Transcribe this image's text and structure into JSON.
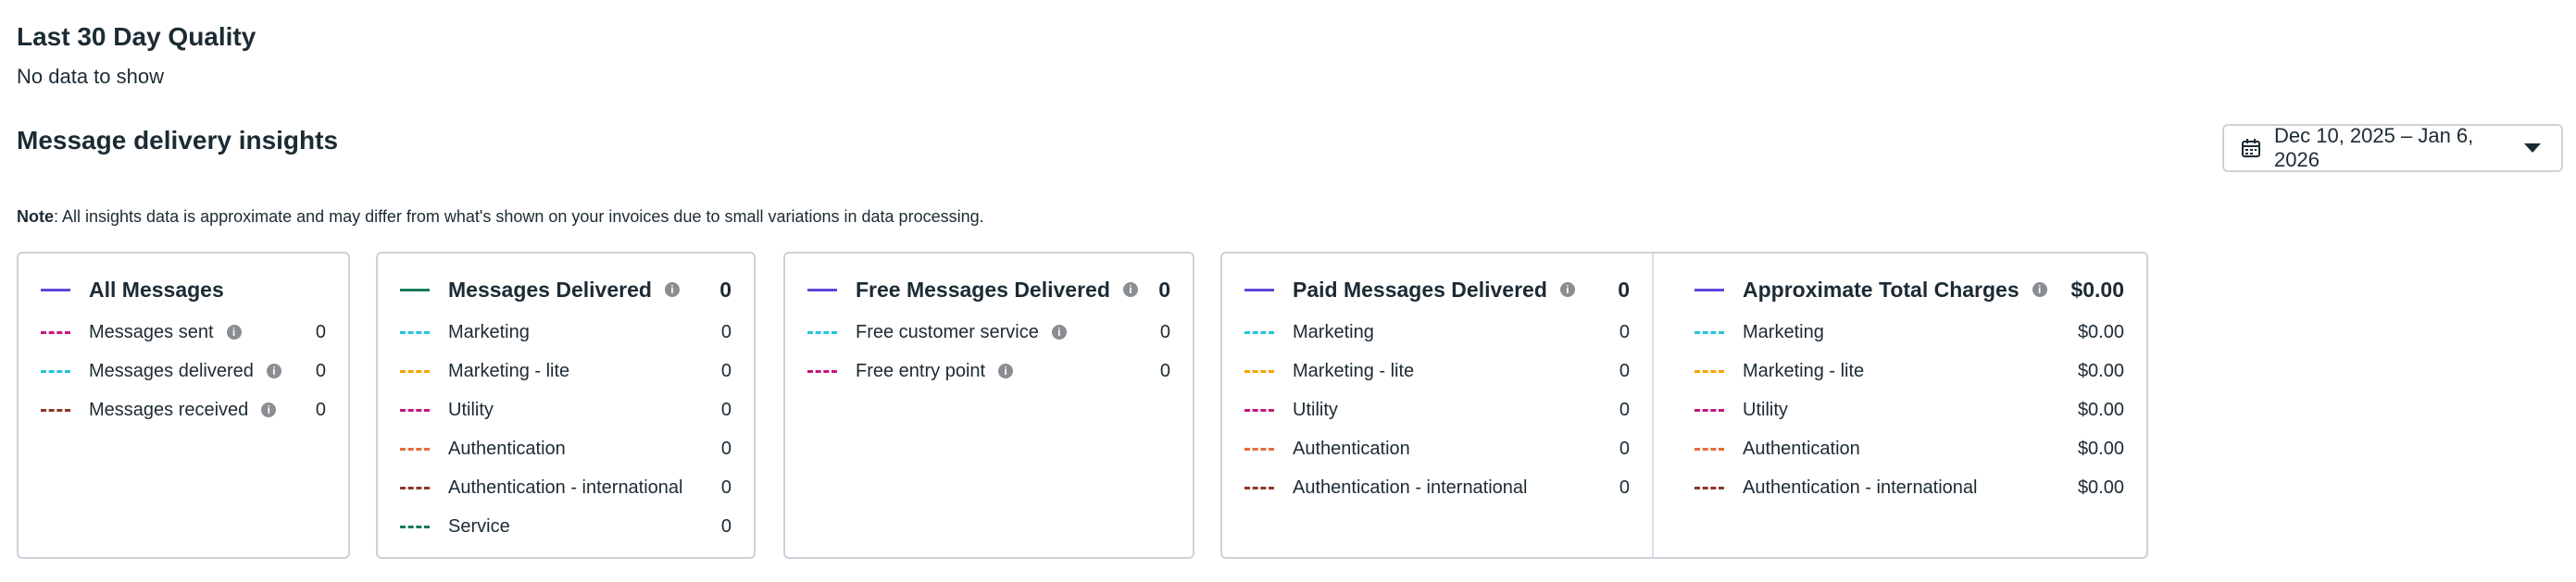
{
  "quality": {
    "title": "Last 30 Day Quality",
    "empty": "No data to show"
  },
  "insights": {
    "title": "Message delivery insights",
    "date_range": "Dec 10, 2025 – Jan 6, 2026",
    "note_bold": "Note",
    "note_text": ": All insights data is approximate and may differ from what's shown on your invoices due to small variations in data processing."
  },
  "colors": {
    "purple": "#5b48d9",
    "teal": "#1a7a5e",
    "pink": "#c2187a",
    "cyan": "#27c3d6",
    "brown": "#8b3a26",
    "orange": "#f5a300",
    "red": "#e86a3a",
    "green": "#1a7a5e"
  },
  "cards": {
    "all": {
      "title": "All Messages",
      "rows": [
        {
          "label": "Messages sent",
          "value": "0"
        },
        {
          "label": "Messages delivered",
          "value": "0"
        },
        {
          "label": "Messages received",
          "value": "0"
        }
      ]
    },
    "delivered": {
      "title": "Messages Delivered",
      "total": "0",
      "rows": [
        {
          "label": "Marketing",
          "value": "0"
        },
        {
          "label": "Marketing - lite",
          "value": "0"
        },
        {
          "label": "Utility",
          "value": "0"
        },
        {
          "label": "Authentication",
          "value": "0"
        },
        {
          "label": "Authentication - international",
          "value": "0"
        },
        {
          "label": "Service",
          "value": "0"
        }
      ]
    },
    "free": {
      "title": "Free Messages Delivered",
      "total": "0",
      "rows": [
        {
          "label": "Free customer service",
          "value": "0"
        },
        {
          "label": "Free entry point",
          "value": "0"
        }
      ]
    },
    "paid": {
      "title": "Paid Messages Delivered",
      "total": "0",
      "rows": [
        {
          "label": "Marketing",
          "value": "0"
        },
        {
          "label": "Marketing - lite",
          "value": "0"
        },
        {
          "label": "Utility",
          "value": "0"
        },
        {
          "label": "Authentication",
          "value": "0"
        },
        {
          "label": "Authentication - international",
          "value": "0"
        }
      ]
    },
    "charges": {
      "title": "Approximate Total Charges",
      "total": "$0.00",
      "rows": [
        {
          "label": "Marketing",
          "value": "$0.00"
        },
        {
          "label": "Marketing - lite",
          "value": "$0.00"
        },
        {
          "label": "Utility",
          "value": "$0.00"
        },
        {
          "label": "Authentication",
          "value": "$0.00"
        },
        {
          "label": "Authentication - international",
          "value": "$0.00"
        }
      ]
    }
  }
}
